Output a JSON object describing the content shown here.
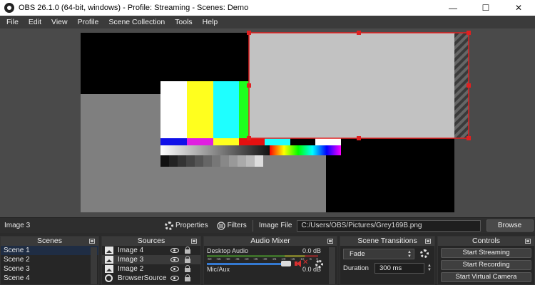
{
  "window": {
    "title": "OBS 26.1.0 (64-bit, windows) - Profile: Streaming - Scenes: Demo",
    "minimize_glyph": "—",
    "maximize_glyph": "☐",
    "close_glyph": "✕"
  },
  "menu": [
    "File",
    "Edit",
    "View",
    "Profile",
    "Scene Collection",
    "Tools",
    "Help"
  ],
  "toolbar": {
    "selected_source": "Image 3",
    "properties_label": "Properties",
    "filters_label": "Filters",
    "image_file_label": "Image File",
    "image_file_path": "C:/Users/OBS/Pictures/Grey169B.png",
    "browse_label": "Browse"
  },
  "scenes": {
    "title": "Scenes",
    "items": [
      "Scene 1",
      "Scene 2",
      "Scene 3",
      "Scene 4"
    ],
    "selected_index": 0
  },
  "sources": {
    "title": "Sources",
    "items": [
      {
        "name": "Image 4",
        "type": "image"
      },
      {
        "name": "Image 3",
        "type": "image"
      },
      {
        "name": "Image 2",
        "type": "image"
      },
      {
        "name": "BrowserSource",
        "type": "browser"
      }
    ],
    "selected_index": 1
  },
  "mixer": {
    "title": "Audio Mixer",
    "channels": [
      {
        "name": "Desktop Audio",
        "db": "0.0 dB",
        "volume": 0.85,
        "muted": true
      },
      {
        "name": "Mic/Aux",
        "db": "0.0 dB"
      }
    ],
    "ticks": [
      "-60",
      "-55",
      "-50",
      "-45",
      "-40",
      "-35",
      "-30",
      "-25",
      "-20",
      "-15",
      "-10",
      "-5",
      "0"
    ]
  },
  "transitions": {
    "title": "Scene Transitions",
    "selected": "Fade",
    "duration_label": "Duration",
    "duration_value": "300 ms"
  },
  "controls": {
    "title": "Controls",
    "buttons": [
      "Start Streaming",
      "Start Recording",
      "Start Virtual Camera"
    ]
  },
  "colors": {
    "selection_red": "#e02020",
    "accent_blue": "#3479d1",
    "panel_bg": "#262626",
    "preview_bg": "#4a4a4a"
  }
}
